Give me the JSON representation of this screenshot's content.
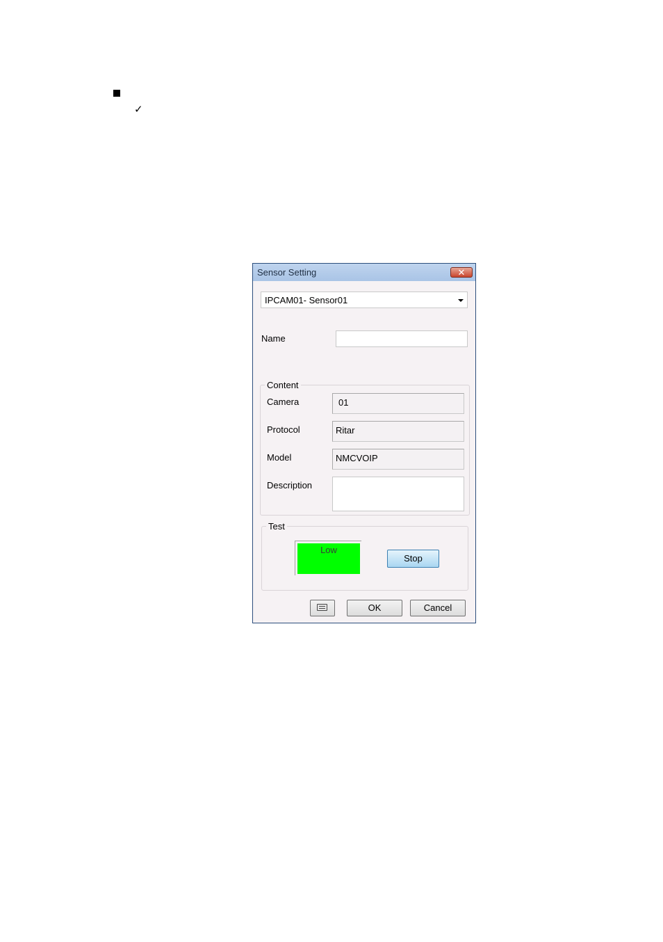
{
  "dialog": {
    "title": "Sensor Setting",
    "close_symbol": "✕",
    "sensor_select": {
      "value": "IPCAM01- Sensor01"
    },
    "name": {
      "label": "Name",
      "value": ""
    },
    "content_group": {
      "title": "Content",
      "camera": {
        "label": "Camera",
        "value": "01"
      },
      "protocol": {
        "label": "Protocol",
        "value": "Ritar"
      },
      "model": {
        "label": "Model",
        "value": "NMCVOIP"
      },
      "description": {
        "label": "Description",
        "value": ""
      }
    },
    "test_group": {
      "title": "Test",
      "indicator": {
        "text": "Low",
        "color": "#00ff00"
      },
      "stop_label": "Stop"
    },
    "buttons": {
      "ok_label": "OK",
      "cancel_label": "Cancel",
      "keyboard_icon": "keyboard-icon"
    }
  },
  "page": {
    "bullet_square": "■",
    "bullet_check": "✓"
  }
}
